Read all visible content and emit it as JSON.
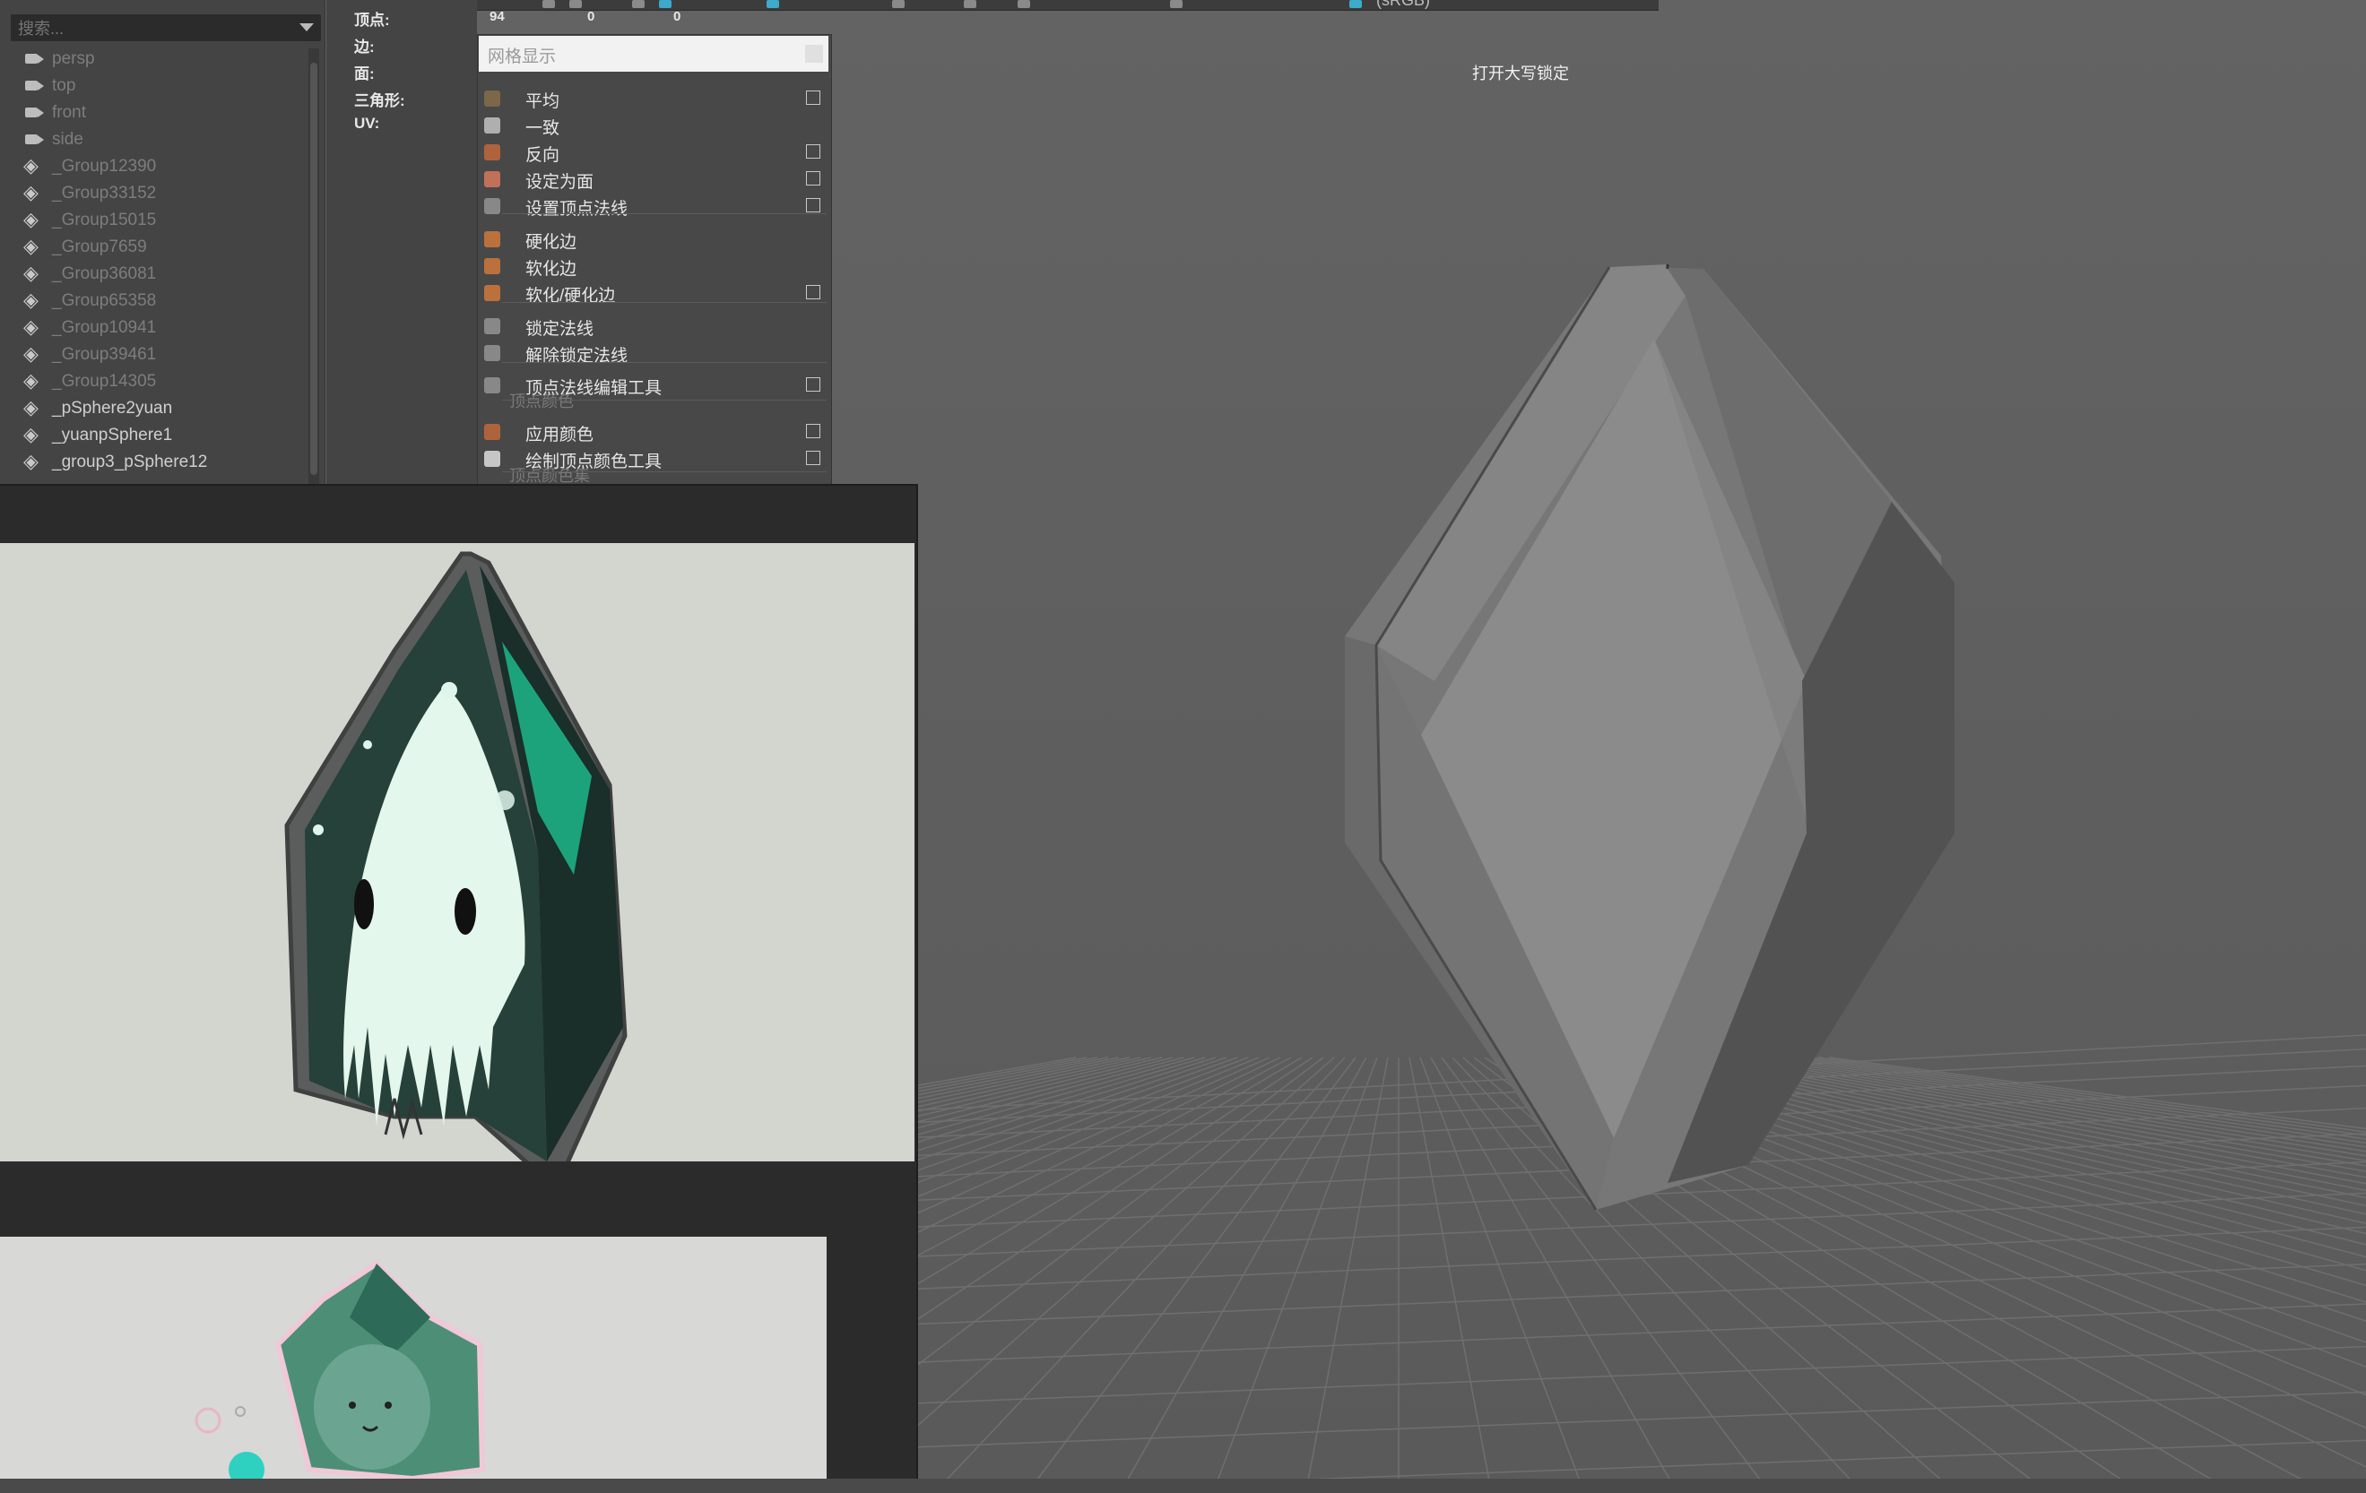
{
  "viewport": {
    "caps_lock_message": "打开大写锁定",
    "color_space_label": "(sRGB)"
  },
  "outliner": {
    "search_placeholder": "搜索...",
    "items": [
      {
        "label": "persp",
        "icon": "camera-icon",
        "dimmed": true
      },
      {
        "label": "top",
        "icon": "camera-icon",
        "dimmed": true
      },
      {
        "label": "front",
        "icon": "camera-icon",
        "dimmed": true
      },
      {
        "label": "side",
        "icon": "camera-icon",
        "dimmed": true
      },
      {
        "label": "_Group12390",
        "icon": "group-icon",
        "dimmed": true
      },
      {
        "label": "_Group33152",
        "icon": "group-icon",
        "dimmed": true
      },
      {
        "label": "_Group15015",
        "icon": "group-icon",
        "dimmed": true
      },
      {
        "label": "_Group7659",
        "icon": "group-icon",
        "dimmed": true
      },
      {
        "label": "_Group36081",
        "icon": "group-icon",
        "dimmed": true
      },
      {
        "label": "_Group65358",
        "icon": "group-icon",
        "dimmed": true
      },
      {
        "label": "_Group10941",
        "icon": "group-icon",
        "dimmed": true
      },
      {
        "label": "_Group39461",
        "icon": "group-icon",
        "dimmed": true
      },
      {
        "label": "_Group14305",
        "icon": "group-icon",
        "dimmed": true
      },
      {
        "label": "_pSphere2yuan",
        "icon": "group-icon",
        "dimmed": false
      },
      {
        "label": "_yuanpSphere1",
        "icon": "group-icon",
        "dimmed": false
      },
      {
        "label": "_group3_pSphere12",
        "icon": "group-icon",
        "dimmed": false
      }
    ]
  },
  "poly_count": {
    "labels": [
      "顶点:",
      "边:",
      "面:",
      "三角形:",
      "UV:"
    ],
    "vertex_values": [
      "94",
      "0",
      "0"
    ]
  },
  "menu": {
    "title": "网格显示",
    "items": [
      {
        "label": "平均",
        "checkbox": true
      },
      {
        "label": "一致",
        "checkbox": false
      },
      {
        "label": "反向",
        "checkbox": true
      },
      {
        "label": "设定为面",
        "checkbox": true
      },
      {
        "label": "设置顶点法线",
        "checkbox": true
      },
      {
        "label": "硬化边",
        "checkbox": false
      },
      {
        "label": "软化边",
        "checkbox": false
      },
      {
        "label": "软化/硬化边",
        "checkbox": true
      },
      {
        "label": "锁定法线",
        "checkbox": false
      },
      {
        "label": "解除锁定法线",
        "checkbox": false
      },
      {
        "label": "顶点法线编辑工具",
        "checkbox": true
      },
      {
        "label": "应用颜色",
        "checkbox": true
      },
      {
        "label": "绘制顶点颜色工具",
        "checkbox": true
      }
    ],
    "section_vertex_color": "顶点颜色",
    "section_vertex_color_set": "顶点颜色集"
  },
  "colors": {
    "viewport_bg": "#5e5e5e",
    "panel_bg": "#444444",
    "accent_green": "#1fd6a0"
  }
}
